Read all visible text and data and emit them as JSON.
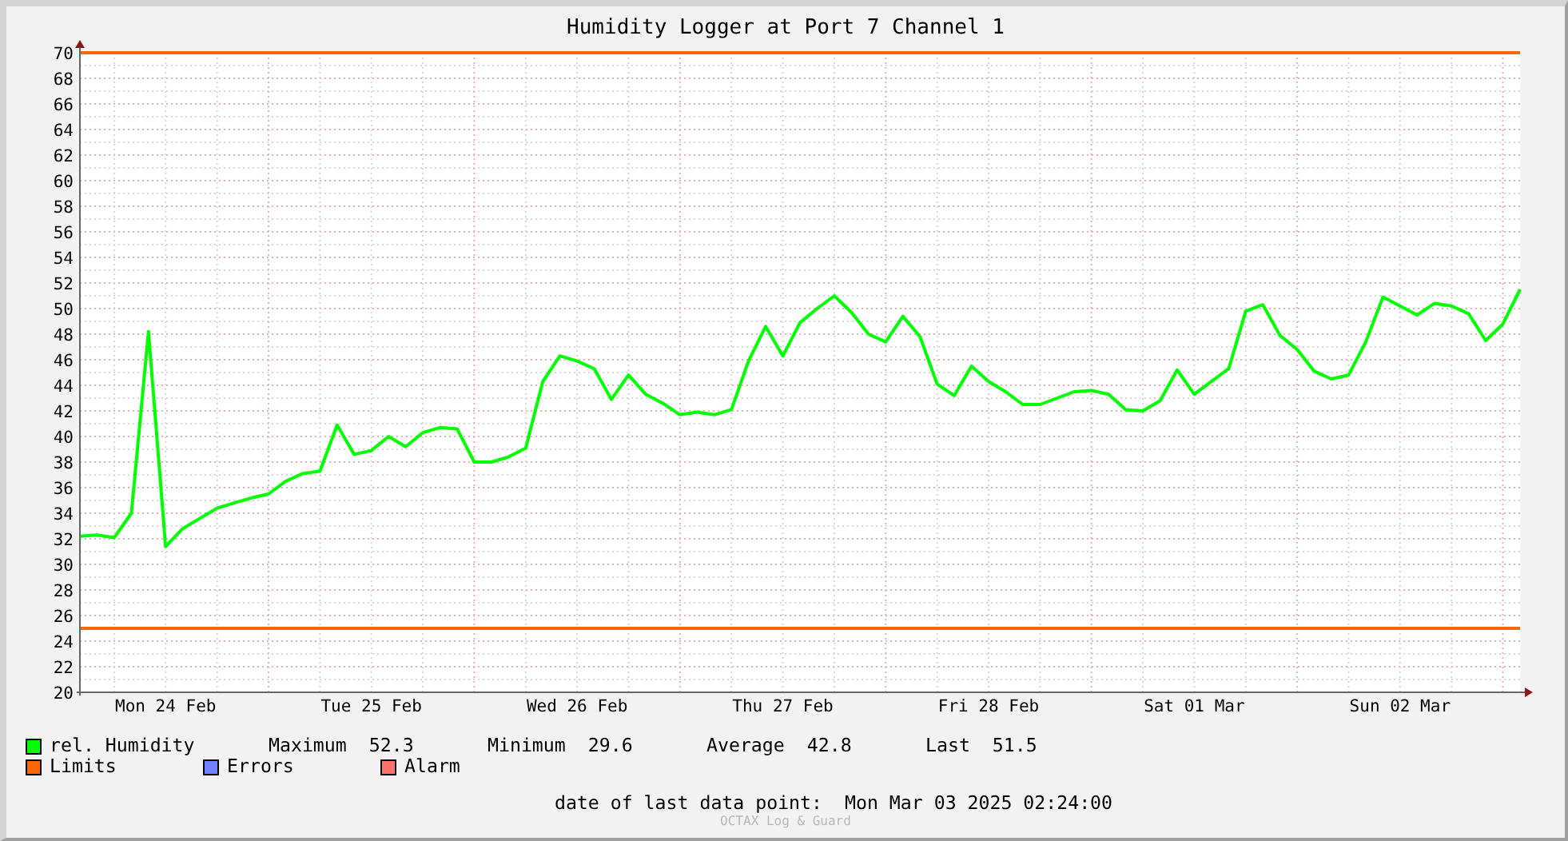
{
  "title": "Humidity Logger at Port 7 Channel 1",
  "chart": {
    "chart_data": {
      "type": "line",
      "categories": [
        null,
        null,
        null,
        null,
        null,
        "Mon 24 Feb",
        null,
        null,
        null,
        null,
        null,
        null,
        null,
        null,
        null,
        null,
        null,
        "Tue 25 Feb",
        null,
        null,
        null,
        null,
        null,
        null,
        null,
        null,
        null,
        null,
        null,
        "Wed 26 Feb",
        null,
        null,
        null,
        null,
        null,
        null,
        null,
        null,
        null,
        null,
        null,
        "Thu 27 Feb",
        null,
        null,
        null,
        null,
        null,
        null,
        null,
        null,
        null,
        null,
        null,
        "Fri 28 Feb",
        null,
        null,
        null,
        null,
        null,
        null,
        null,
        null,
        null,
        null,
        null,
        "Sat 01 Mar",
        null,
        null,
        null,
        null,
        null,
        null,
        null,
        null,
        null,
        null,
        null,
        "Sun 02 Mar",
        null,
        null,
        null,
        null,
        null,
        null,
        null
      ],
      "series": [
        {
          "name": "rel. Humidity",
          "color": "#00ff00",
          "values": [
            32.2,
            32.3,
            32.1,
            34.0,
            48.2,
            31.4,
            32.8,
            33.6,
            34.4,
            34.8,
            35.2,
            35.5,
            36.5,
            37.1,
            37.3,
            40.9,
            38.6,
            38.9,
            40.0,
            39.2,
            40.3,
            40.7,
            40.6,
            38.0,
            38.0,
            38.4,
            39.1,
            44.3,
            46.3,
            45.9,
            45.3,
            42.9,
            44.8,
            43.3,
            42.6,
            41.7,
            41.9,
            41.7,
            42.1,
            45.9,
            48.6,
            46.3,
            48.9,
            50.0,
            51.0,
            49.7,
            48.0,
            47.4,
            49.4,
            47.8,
            44.1,
            43.2,
            45.5,
            44.3,
            43.5,
            42.5,
            42.5,
            43.0,
            43.5,
            43.6,
            43.3,
            42.1,
            42.0,
            42.8,
            45.2,
            43.3,
            44.3,
            45.3,
            49.8,
            50.3,
            47.9,
            46.8,
            45.1,
            44.5,
            44.8,
            47.4,
            50.9,
            50.2,
            49.5,
            50.4,
            50.2,
            49.6,
            47.5,
            48.8,
            51.5
          ]
        }
      ],
      "ylim": [
        20,
        70
      ],
      "yticks": [
        20,
        22,
        24,
        26,
        28,
        30,
        32,
        34,
        36,
        38,
        40,
        42,
        44,
        46,
        48,
        50,
        52,
        54,
        56,
        58,
        60,
        62,
        64,
        66,
        68,
        70
      ],
      "grid": true,
      "ref_lines": [
        {
          "axis": "y",
          "value": 70
        },
        {
          "axis": "y",
          "value": 25
        }
      ]
    }
  },
  "legend": [
    {
      "stats": [
        {
          "label": "Maximum",
          "value": "52.3"
        },
        {
          "label": "Minimum",
          "value": "29.6"
        },
        {
          "label": "Average",
          "value": "42.8"
        },
        {
          "label": "Last",
          "value": "51.5"
        }
      ]
    },
    {
      "label": "Limits",
      "color": "#ff6600"
    },
    {
      "label": "Errors",
      "color": "#7080ff"
    },
    {
      "label": "Alarm",
      "color": "#ff7070"
    }
  ],
  "last_data_point": {
    "label": "date of last data point:",
    "value": "Mon Mar 03 2025 02:24:00"
  },
  "footer": "OCTAX Log & Guard"
}
